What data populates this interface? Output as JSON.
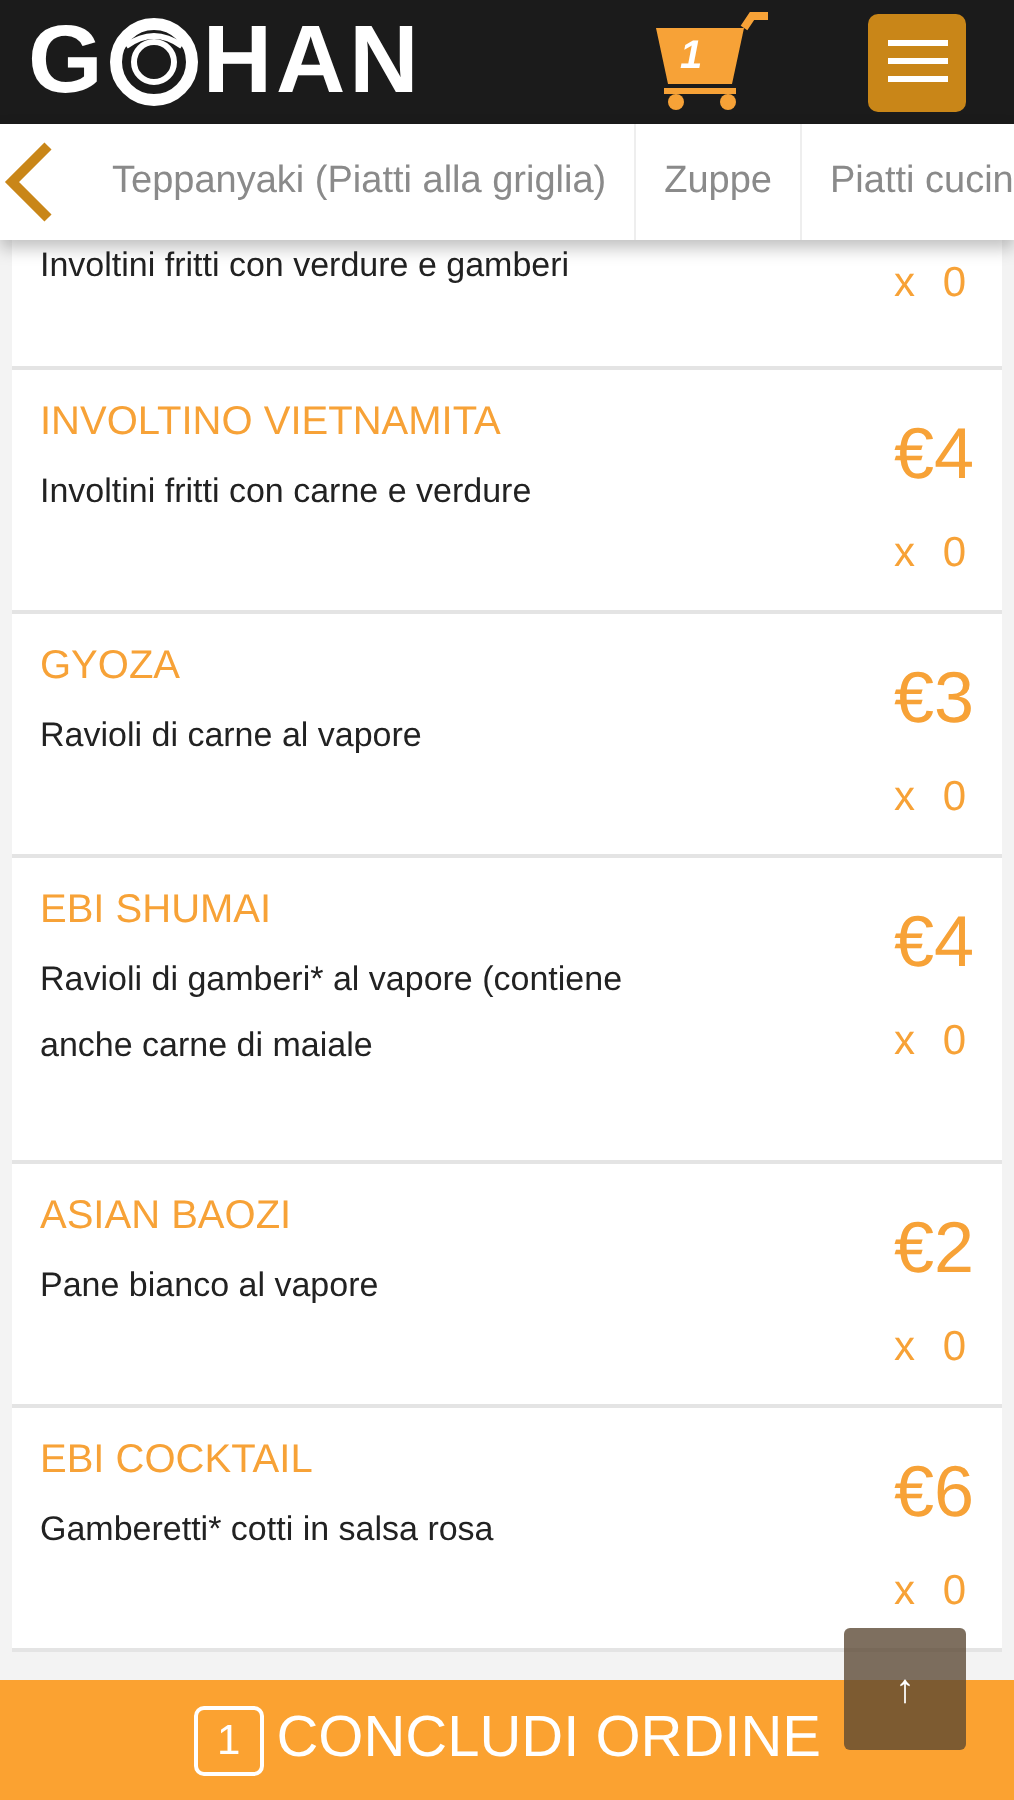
{
  "header": {
    "logo_before": "G",
    "logo_after": "HAN",
    "cart_count": "1"
  },
  "tabs": [
    {
      "label": "Teppanyaki (Piatti alla griglia)",
      "selected": false
    },
    {
      "label": "Zuppe",
      "selected": false
    },
    {
      "label": "Piatti cucin",
      "selected": false
    }
  ],
  "items": [
    {
      "kind": "partial",
      "description": "Involtini fritti con verdure e gamberi",
      "quantity": "x 0"
    },
    {
      "kind": "full",
      "name": "INVOLTINO VIETNAMITA",
      "description": "Involtini fritti con carne e verdure",
      "price": "€4",
      "quantity": "x 0"
    },
    {
      "kind": "full",
      "name": "GYOZA",
      "description": "Ravioli di carne al vapore",
      "price": "€3",
      "quantity": "x 0"
    },
    {
      "kind": "full",
      "name": "EBI SHUMAI",
      "description": "Ravioli di gamberi* al vapore (contiene anche carne di maiale",
      "price": "€4",
      "quantity": "x 0"
    },
    {
      "kind": "full",
      "name": "ASIAN BAOZI",
      "description": "Pane bianco al vapore",
      "price": "€2",
      "quantity": "x 0"
    },
    {
      "kind": "full",
      "name": "EBI COCKTAIL",
      "description": "Gamberetti* cotti in salsa rosa",
      "price": "€6",
      "quantity": "x 0"
    }
  ],
  "footer": {
    "count": "1",
    "label": "CONCLUDI ORDINE"
  },
  "scroll_top": {
    "label": "↑"
  }
}
